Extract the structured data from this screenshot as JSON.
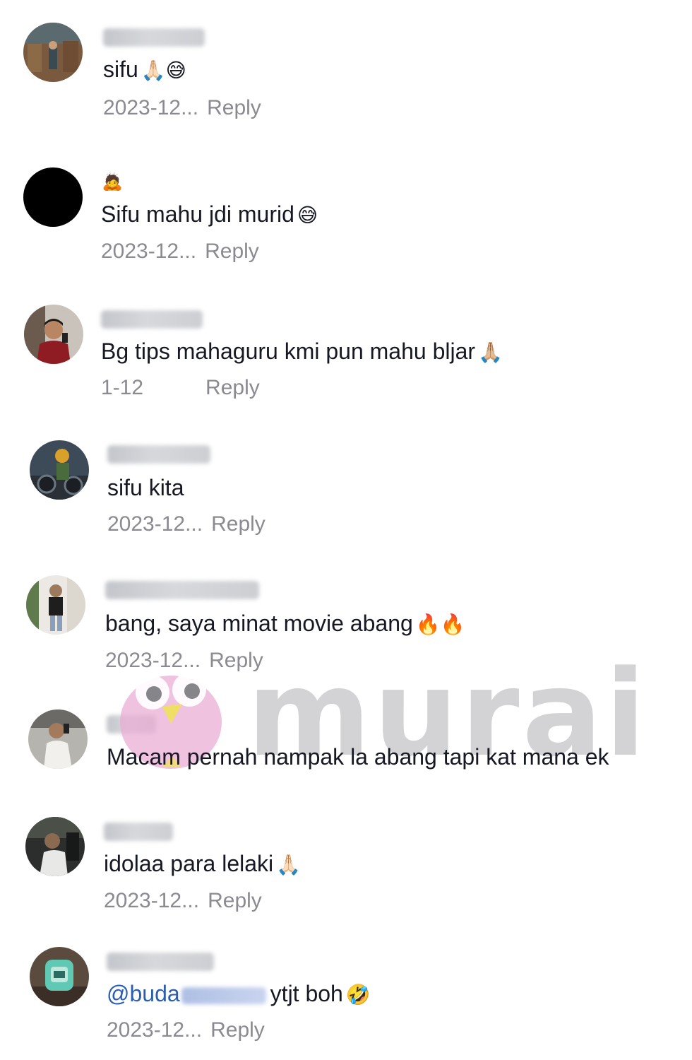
{
  "comments": [
    {
      "text": "sifu",
      "emoji": "🙏🏻😅",
      "date": "2023-12...",
      "reply": "Reply"
    },
    {
      "username_icon": "🙇",
      "text": "Sifu mahu jdi murid",
      "emoji": "😅",
      "date": "2023-12...",
      "reply": "Reply"
    },
    {
      "text": "Bg tips mahaguru kmi pun mahu bljar",
      "emoji": "🙏🏼",
      "date": "1-12",
      "reply": "Reply"
    },
    {
      "text": "sifu kita",
      "date": "2023-12...",
      "reply": "Reply"
    },
    {
      "text": "bang, saya minat movie abang",
      "emoji": "🔥🔥",
      "date": "2023-12...",
      "reply": "Reply"
    },
    {
      "text": "Macam pernah nampak la abang tapi kat mana ek"
    },
    {
      "text": "idolaa para lelaki",
      "emoji": "🙏🏻",
      "date": "2023-12...",
      "reply": "Reply"
    },
    {
      "mention": "@buda",
      "text": "ytjt boh",
      "emoji": "🤣",
      "date": "2023-12...",
      "reply": "Reply"
    }
  ],
  "watermark": {
    "text": "murai"
  },
  "colors": {
    "text": "#161823",
    "meta": "#8a8b91",
    "mention": "#2b5db3",
    "background": "#ffffff"
  }
}
